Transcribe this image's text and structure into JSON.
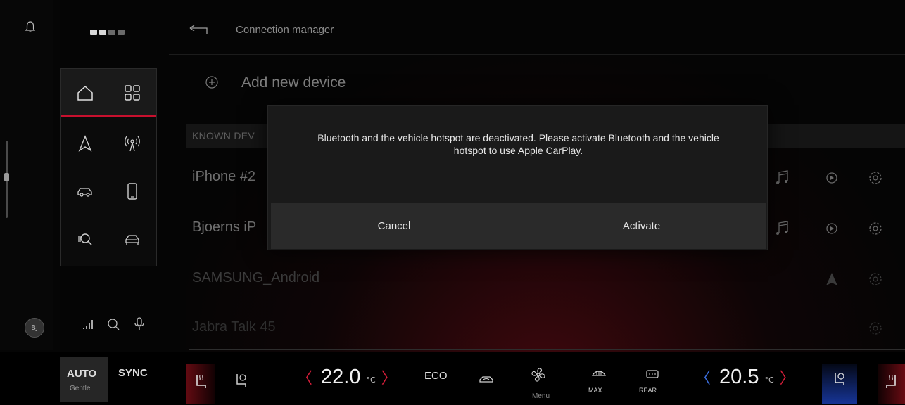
{
  "header": {
    "title": "Connection manager"
  },
  "user": {
    "initials": "BJ"
  },
  "list": {
    "add_label": "Add new device",
    "section_label": "KNOWN DEV",
    "devices": [
      {
        "name": "iPhone #2"
      },
      {
        "name": "Bjoerns iP"
      },
      {
        "name": "SAMSUNG_Android"
      },
      {
        "name": "Jabra Talk 45"
      }
    ]
  },
  "dialog": {
    "message": "Bluetooth and the vehicle hotspot are deactivated. Please activate Bluetooth and the vehicle hotspot to use Apple CarPlay.",
    "cancel_label": "Cancel",
    "activate_label": "Activate"
  },
  "climate": {
    "auto_label": "AUTO",
    "auto_sub": "Gentle",
    "sync_label": "SYNC",
    "left_temp": "22.0",
    "right_temp": "20.5",
    "temp_unit": "°C",
    "eco_label": "ECO",
    "menu_label": "Menu",
    "max_label": "MAX",
    "rear_label": "REAR"
  },
  "colors": {
    "accent_red": "#c8102e",
    "accent_blue": "#3b6fe0"
  }
}
